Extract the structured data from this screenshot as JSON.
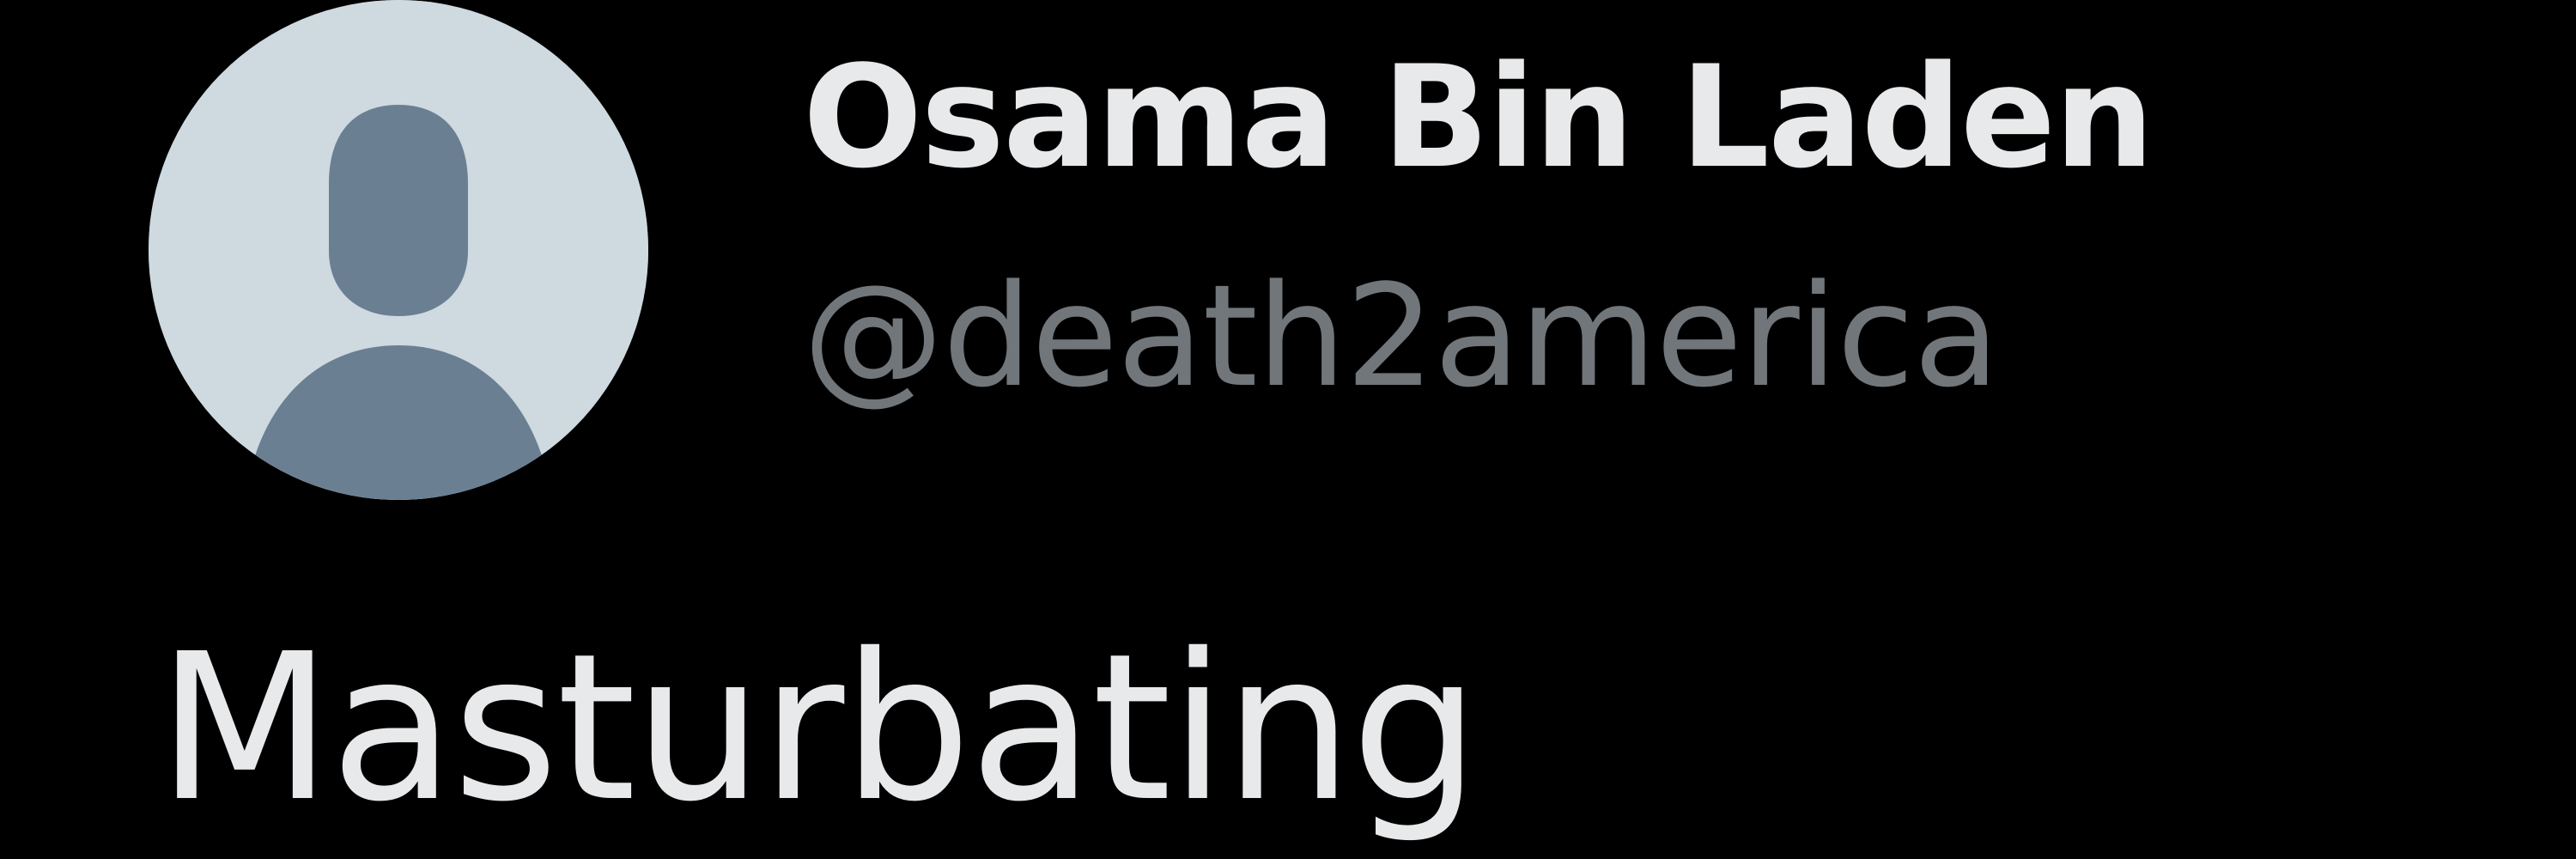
{
  "tweet": {
    "author": {
      "display_name": "Osama Bin Laden",
      "handle": "@death2america",
      "avatar_icon": "default-avatar-icon"
    },
    "text": "Masturbating"
  },
  "colors": {
    "background": "#000000",
    "primary_text": "#e7e9ea",
    "secondary_text": "#71767b",
    "avatar_background": "#ced9e0",
    "avatar_silhouette": "#6b7f92"
  }
}
